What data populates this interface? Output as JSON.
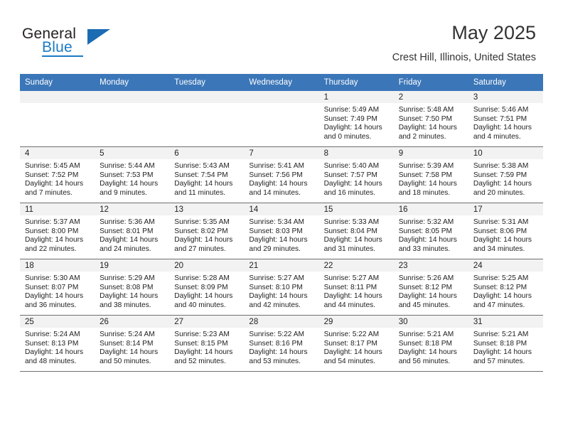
{
  "brand": {
    "name_top": "General",
    "name_bottom": "Blue"
  },
  "header": {
    "title": "May 2025",
    "subtitle": "Crest Hill, Illinois, United States"
  },
  "theme": {
    "header_blue": "#3b76b8",
    "band_gray": "#f2f2f2",
    "logo_blue": "#1b7ac4",
    "text": "#222222"
  },
  "calendar": {
    "weekday_headers": [
      "Sunday",
      "Monday",
      "Tuesday",
      "Wednesday",
      "Thursday",
      "Friday",
      "Saturday"
    ],
    "weeks": [
      [
        {
          "day": "",
          "empty": true
        },
        {
          "day": "",
          "empty": true
        },
        {
          "day": "",
          "empty": true
        },
        {
          "day": "",
          "empty": true
        },
        {
          "day": "1",
          "sunrise": "Sunrise: 5:49 AM",
          "sunset": "Sunset: 7:49 PM",
          "daylight1": "Daylight: 14 hours",
          "daylight2": "and 0 minutes."
        },
        {
          "day": "2",
          "sunrise": "Sunrise: 5:48 AM",
          "sunset": "Sunset: 7:50 PM",
          "daylight1": "Daylight: 14 hours",
          "daylight2": "and 2 minutes."
        },
        {
          "day": "3",
          "sunrise": "Sunrise: 5:46 AM",
          "sunset": "Sunset: 7:51 PM",
          "daylight1": "Daylight: 14 hours",
          "daylight2": "and 4 minutes."
        }
      ],
      [
        {
          "day": "4",
          "sunrise": "Sunrise: 5:45 AM",
          "sunset": "Sunset: 7:52 PM",
          "daylight1": "Daylight: 14 hours",
          "daylight2": "and 7 minutes."
        },
        {
          "day": "5",
          "sunrise": "Sunrise: 5:44 AM",
          "sunset": "Sunset: 7:53 PM",
          "daylight1": "Daylight: 14 hours",
          "daylight2": "and 9 minutes."
        },
        {
          "day": "6",
          "sunrise": "Sunrise: 5:43 AM",
          "sunset": "Sunset: 7:54 PM",
          "daylight1": "Daylight: 14 hours",
          "daylight2": "and 11 minutes."
        },
        {
          "day": "7",
          "sunrise": "Sunrise: 5:41 AM",
          "sunset": "Sunset: 7:56 PM",
          "daylight1": "Daylight: 14 hours",
          "daylight2": "and 14 minutes."
        },
        {
          "day": "8",
          "sunrise": "Sunrise: 5:40 AM",
          "sunset": "Sunset: 7:57 PM",
          "daylight1": "Daylight: 14 hours",
          "daylight2": "and 16 minutes."
        },
        {
          "day": "9",
          "sunrise": "Sunrise: 5:39 AM",
          "sunset": "Sunset: 7:58 PM",
          "daylight1": "Daylight: 14 hours",
          "daylight2": "and 18 minutes."
        },
        {
          "day": "10",
          "sunrise": "Sunrise: 5:38 AM",
          "sunset": "Sunset: 7:59 PM",
          "daylight1": "Daylight: 14 hours",
          "daylight2": "and 20 minutes."
        }
      ],
      [
        {
          "day": "11",
          "sunrise": "Sunrise: 5:37 AM",
          "sunset": "Sunset: 8:00 PM",
          "daylight1": "Daylight: 14 hours",
          "daylight2": "and 22 minutes."
        },
        {
          "day": "12",
          "sunrise": "Sunrise: 5:36 AM",
          "sunset": "Sunset: 8:01 PM",
          "daylight1": "Daylight: 14 hours",
          "daylight2": "and 24 minutes."
        },
        {
          "day": "13",
          "sunrise": "Sunrise: 5:35 AM",
          "sunset": "Sunset: 8:02 PM",
          "daylight1": "Daylight: 14 hours",
          "daylight2": "and 27 minutes."
        },
        {
          "day": "14",
          "sunrise": "Sunrise: 5:34 AM",
          "sunset": "Sunset: 8:03 PM",
          "daylight1": "Daylight: 14 hours",
          "daylight2": "and 29 minutes."
        },
        {
          "day": "15",
          "sunrise": "Sunrise: 5:33 AM",
          "sunset": "Sunset: 8:04 PM",
          "daylight1": "Daylight: 14 hours",
          "daylight2": "and 31 minutes."
        },
        {
          "day": "16",
          "sunrise": "Sunrise: 5:32 AM",
          "sunset": "Sunset: 8:05 PM",
          "daylight1": "Daylight: 14 hours",
          "daylight2": "and 33 minutes."
        },
        {
          "day": "17",
          "sunrise": "Sunrise: 5:31 AM",
          "sunset": "Sunset: 8:06 PM",
          "daylight1": "Daylight: 14 hours",
          "daylight2": "and 34 minutes."
        }
      ],
      [
        {
          "day": "18",
          "sunrise": "Sunrise: 5:30 AM",
          "sunset": "Sunset: 8:07 PM",
          "daylight1": "Daylight: 14 hours",
          "daylight2": "and 36 minutes."
        },
        {
          "day": "19",
          "sunrise": "Sunrise: 5:29 AM",
          "sunset": "Sunset: 8:08 PM",
          "daylight1": "Daylight: 14 hours",
          "daylight2": "and 38 minutes."
        },
        {
          "day": "20",
          "sunrise": "Sunrise: 5:28 AM",
          "sunset": "Sunset: 8:09 PM",
          "daylight1": "Daylight: 14 hours",
          "daylight2": "and 40 minutes."
        },
        {
          "day": "21",
          "sunrise": "Sunrise: 5:27 AM",
          "sunset": "Sunset: 8:10 PM",
          "daylight1": "Daylight: 14 hours",
          "daylight2": "and 42 minutes."
        },
        {
          "day": "22",
          "sunrise": "Sunrise: 5:27 AM",
          "sunset": "Sunset: 8:11 PM",
          "daylight1": "Daylight: 14 hours",
          "daylight2": "and 44 minutes."
        },
        {
          "day": "23",
          "sunrise": "Sunrise: 5:26 AM",
          "sunset": "Sunset: 8:12 PM",
          "daylight1": "Daylight: 14 hours",
          "daylight2": "and 45 minutes."
        },
        {
          "day": "24",
          "sunrise": "Sunrise: 5:25 AM",
          "sunset": "Sunset: 8:12 PM",
          "daylight1": "Daylight: 14 hours",
          "daylight2": "and 47 minutes."
        }
      ],
      [
        {
          "day": "25",
          "sunrise": "Sunrise: 5:24 AM",
          "sunset": "Sunset: 8:13 PM",
          "daylight1": "Daylight: 14 hours",
          "daylight2": "and 48 minutes."
        },
        {
          "day": "26",
          "sunrise": "Sunrise: 5:24 AM",
          "sunset": "Sunset: 8:14 PM",
          "daylight1": "Daylight: 14 hours",
          "daylight2": "and 50 minutes."
        },
        {
          "day": "27",
          "sunrise": "Sunrise: 5:23 AM",
          "sunset": "Sunset: 8:15 PM",
          "daylight1": "Daylight: 14 hours",
          "daylight2": "and 52 minutes."
        },
        {
          "day": "28",
          "sunrise": "Sunrise: 5:22 AM",
          "sunset": "Sunset: 8:16 PM",
          "daylight1": "Daylight: 14 hours",
          "daylight2": "and 53 minutes."
        },
        {
          "day": "29",
          "sunrise": "Sunrise: 5:22 AM",
          "sunset": "Sunset: 8:17 PM",
          "daylight1": "Daylight: 14 hours",
          "daylight2": "and 54 minutes."
        },
        {
          "day": "30",
          "sunrise": "Sunrise: 5:21 AM",
          "sunset": "Sunset: 8:18 PM",
          "daylight1": "Daylight: 14 hours",
          "daylight2": "and 56 minutes."
        },
        {
          "day": "31",
          "sunrise": "Sunrise: 5:21 AM",
          "sunset": "Sunset: 8:18 PM",
          "daylight1": "Daylight: 14 hours",
          "daylight2": "and 57 minutes."
        }
      ]
    ]
  }
}
